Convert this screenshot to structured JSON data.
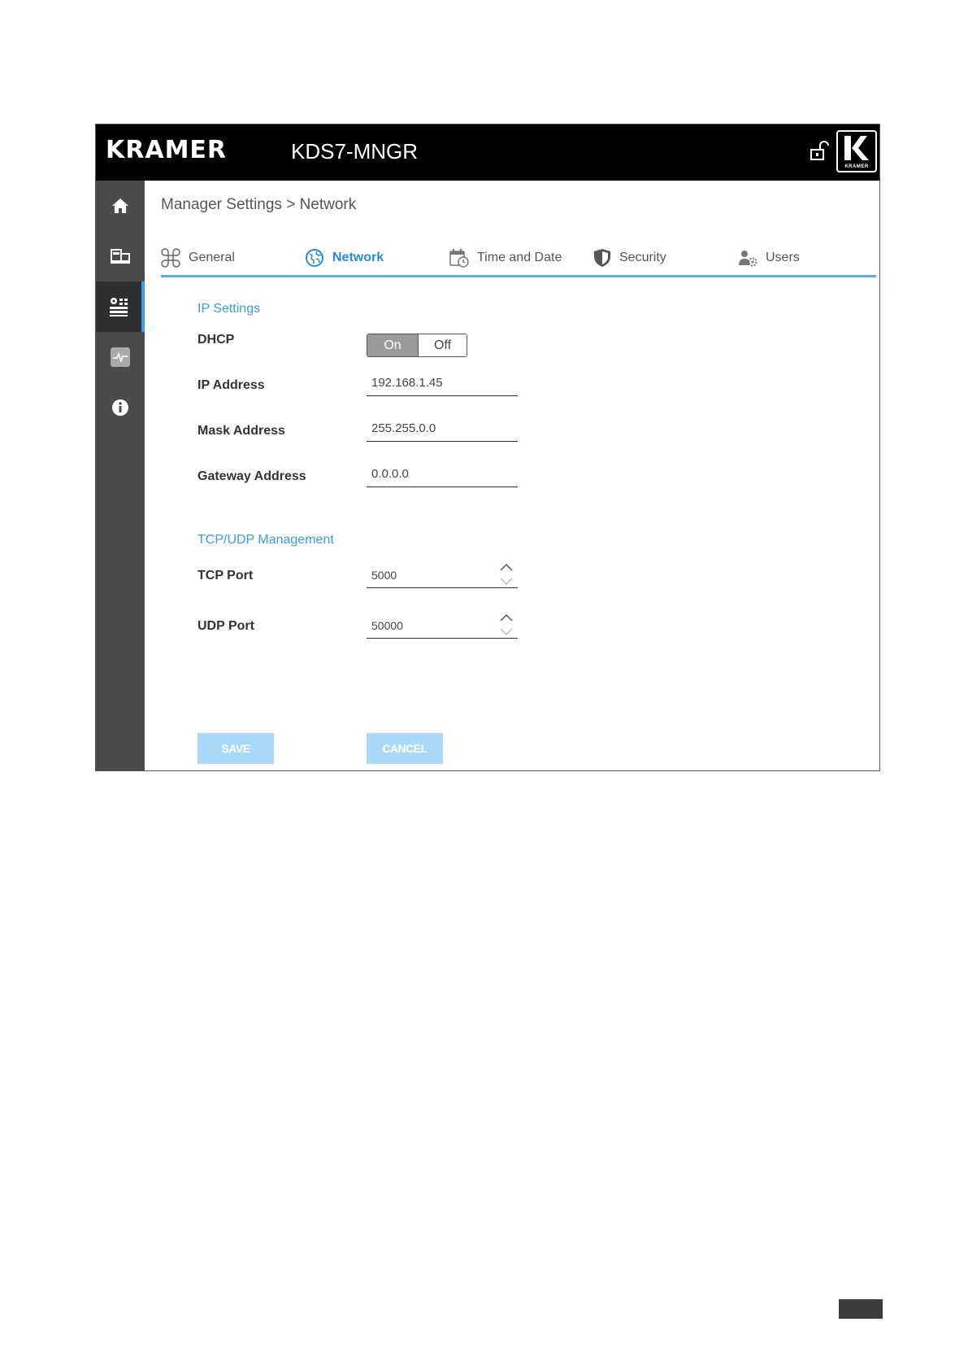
{
  "header": {
    "brand": "KRAMER",
    "device_name": "KDS7-MNGR",
    "badge_text": "KRAMER"
  },
  "sidebar": {
    "items": [
      {
        "icon": "home-icon",
        "active": false
      },
      {
        "icon": "devices-icon",
        "active": false
      },
      {
        "icon": "settings-icon",
        "active": true
      },
      {
        "icon": "diagnostics-icon",
        "active": false
      },
      {
        "icon": "info-icon",
        "active": false
      }
    ]
  },
  "breadcrumb": "Manager Settings > Network",
  "tabs": [
    {
      "label": "General",
      "icon": "general-icon"
    },
    {
      "label": "Network",
      "icon": "globe-icon",
      "active": true
    },
    {
      "label": "Time and Date",
      "icon": "calendar-clock-icon"
    },
    {
      "label": "Security",
      "icon": "shield-icon"
    },
    {
      "label": "Users",
      "icon": "users-gear-icon"
    }
  ],
  "ip_settings": {
    "title": "IP Settings",
    "dhcp_label": "DHCP",
    "dhcp_on": "On",
    "dhcp_off": "Off",
    "ip_label": "IP Address",
    "ip_value": "192.168.1.45",
    "mask_label": "Mask Address",
    "mask_value": "255.255.0.0",
    "gateway_label": "Gateway Address",
    "gateway_value": "0.0.0.0"
  },
  "tcp_udp": {
    "title": "TCP/UDP Management",
    "tcp_label": "TCP Port",
    "tcp_value": "5000",
    "udp_label": "UDP Port",
    "udp_value": "50000"
  },
  "actions": {
    "save": "SAVE",
    "cancel": "CANCEL"
  },
  "colors": {
    "accent": "#3a9be0",
    "button": "#a9d8f8",
    "sidebar": "#4b4b4b",
    "topbar": "#000000"
  }
}
